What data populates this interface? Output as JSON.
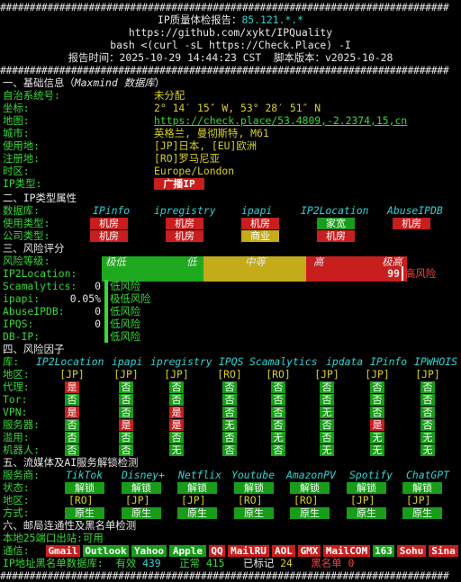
{
  "header": {
    "hash_line": "############################################################################",
    "title_prefix": "IP质量体检报告：",
    "title_ip": "85.121.*.*",
    "repo_url": "https://github.com/xykt/IPQuality",
    "command": "bash <(curl -sL https://Check.Place) -I",
    "report_line": "报告时间：2025-10-29 14:44:23 CST  脚本版本：v2025-10-28"
  },
  "basic": {
    "title": "一、基础信息（",
    "title_src": "Maxmind 数据库",
    "title_end": "）",
    "rows": [
      {
        "label": "自治系统号:",
        "value": "未分配"
      },
      {
        "label": "坐标:",
        "value": "2° 14′ 15″ W, 53° 28′ 51″ N"
      },
      {
        "label": "地图:",
        "value": "https://check.place/53.4809,-2.2374,15,cn"
      },
      {
        "label": "城市:",
        "value": "英格兰, 曼彻斯特, M61"
      },
      {
        "label": "使用地:",
        "value": "[JP]日本, [EU]欧洲"
      },
      {
        "label": "注册地:",
        "value": "[RO]罗马尼亚"
      },
      {
        "label": "时区:",
        "value": "Europe/London"
      },
      {
        "label": "IP类型:",
        "value": "广播IP"
      }
    ]
  },
  "iptype": {
    "title": "二、IP类型属性",
    "db_label": "数据库:",
    "dbs": [
      "IPinfo",
      "ipregistry",
      "ipapi",
      "IP2Location",
      "AbuseIPDB"
    ],
    "use_label": "使用类型:",
    "use": [
      "机房",
      "机房",
      "机房",
      "家宽",
      "机房"
    ],
    "company_label": "公司类型:",
    "company": [
      "机房",
      "机房",
      "商业",
      "机房"
    ]
  },
  "risk": {
    "title": "三、风险评分",
    "level_label": "风险等级:",
    "levels": [
      "极低",
      "低",
      "中等",
      "高",
      "极高"
    ],
    "items": [
      {
        "label": "IP2Location:",
        "score": "99",
        "verdict": "高风险",
        "score_pct": 99
      },
      {
        "label": "Scamalytics:",
        "score": "0",
        "verdict": "低风险",
        "score_pct": 0
      },
      {
        "label": "ipapi:",
        "score": "0.05%",
        "verdict": "极低风险",
        "score_pct": 0
      },
      {
        "label": "AbuseIPDB:",
        "score": "0",
        "verdict": "低风险",
        "score_pct": 0
      },
      {
        "label": "IPQS:",
        "score": "0",
        "verdict": "低风险",
        "score_pct": 0
      },
      {
        "label": "DB-IP:",
        "score": "",
        "verdict": "低风险",
        "score_pct": 0
      }
    ]
  },
  "factors": {
    "title": "四、风险因子",
    "lib_label": "库:",
    "libs": [
      "IP2Location",
      "ipapi",
      "ipregistry",
      "IPQS",
      "Scamalytics",
      "ipdata",
      "IPinfo",
      "IPWHOIS"
    ],
    "region_label": "地区:",
    "regions": [
      "[JP]",
      "[JP]",
      "[JP]",
      "[RO]",
      "[RO]",
      "[JP]",
      "[JP]",
      "[JP]"
    ],
    "rows": [
      {
        "label": "代理:",
        "vals": [
          "是",
          "否",
          "否",
          "否",
          "否",
          "否",
          "否",
          "否"
        ]
      },
      {
        "label": "Tor:",
        "vals": [
          "否",
          "否",
          "否",
          "否",
          "否",
          "否",
          "否",
          "否"
        ]
      },
      {
        "label": "VPN:",
        "vals": [
          "是",
          "否",
          "是",
          "否",
          "否",
          "无",
          "否",
          "否"
        ]
      },
      {
        "label": "服务器:",
        "vals": [
          "否",
          "是",
          "是",
          "无",
          "否",
          "否",
          "是",
          "否"
        ]
      },
      {
        "label": "滥用:",
        "vals": [
          "否",
          "否",
          "否",
          "否",
          "无",
          "否",
          "无",
          "无"
        ]
      },
      {
        "label": "机器人:",
        "vals": [
          "否",
          "否",
          "无",
          "否",
          "否",
          "无",
          "无",
          "无"
        ]
      }
    ]
  },
  "media": {
    "title": "五、流媒体及AI服务解锁检测",
    "svc_label": "服务商:",
    "services": [
      "TikTok",
      "Disney+",
      "Netflix",
      "Youtube",
      "AmazonPV",
      "Spotify",
      "ChatGPT"
    ],
    "status_label": "状态:",
    "status": [
      "解锁",
      "解锁",
      "解锁",
      "解锁",
      "解锁",
      "解锁",
      "解锁"
    ],
    "region_label": "地区:",
    "regions": [
      "[RO]",
      "[JP]",
      "[JP]",
      "[RO]",
      "[RO]",
      "[JP]",
      "[JP]"
    ],
    "method_label": "方式:",
    "methods": [
      "原生",
      "原生",
      "原生",
      "原生",
      "原生",
      "原生",
      "原生"
    ]
  },
  "mail": {
    "title": "六、邮局连通性及黑名单检测",
    "port25_label": "本地25端口出站:",
    "port25_value": "可用",
    "comm_label": "通信:",
    "providers": [
      {
        "name": "Gmail",
        "ok": false
      },
      {
        "name": "Outlook",
        "ok": true
      },
      {
        "name": "Yahoo",
        "ok": true
      },
      {
        "name": "Apple",
        "ok": true
      },
      {
        "name": "QQ",
        "ok": false
      },
      {
        "name": "MailRU",
        "ok": false
      },
      {
        "name": "AOL",
        "ok": false
      },
      {
        "name": "GMX",
        "ok": false
      },
      {
        "name": "MailCOM",
        "ok": false
      },
      {
        "name": "163",
        "ok": true
      },
      {
        "name": "Sohu",
        "ok": false
      },
      {
        "name": "Sina",
        "ok": false
      }
    ],
    "bl_label": "IP地址黑名单数据库:",
    "bl_valid_label": "有效",
    "bl_valid": "439",
    "bl_normal_label": "正常",
    "bl_normal": "415",
    "bl_marked_label": "已标记",
    "bl_marked": "24",
    "bl_black_label": "黑名单",
    "bl_black": "0"
  },
  "colors": {
    "red": "#c81e1e",
    "green": "#199c19",
    "yellow": "#c3ab1a",
    "cyan": "#2fd4d4"
  }
}
